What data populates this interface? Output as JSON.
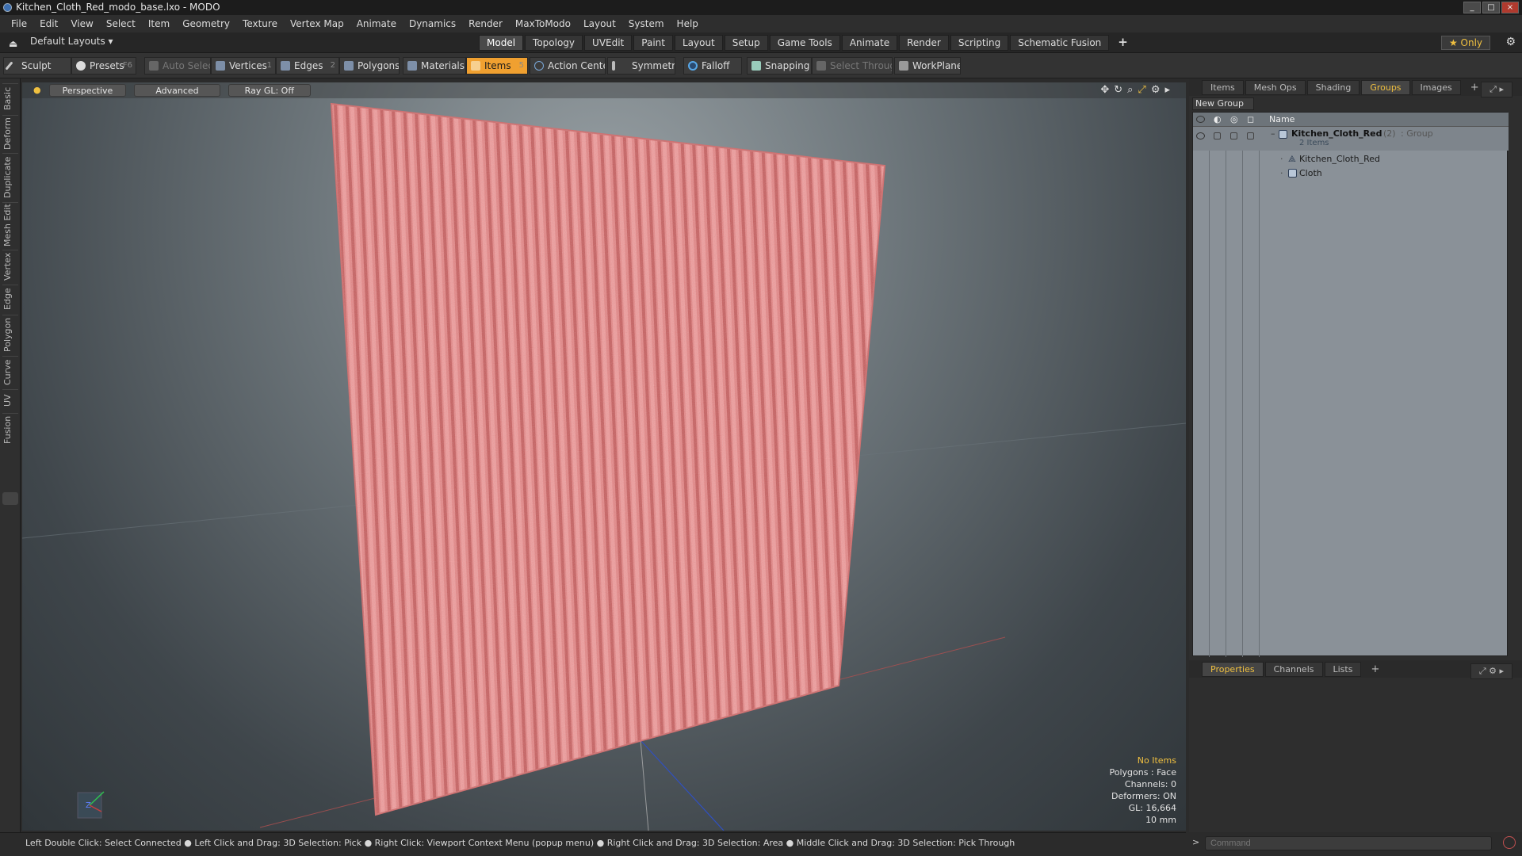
{
  "window": {
    "title": "Kitchen_Cloth_Red_modo_base.lxo - MODO"
  },
  "menu": [
    "File",
    "Edit",
    "View",
    "Select",
    "Item",
    "Geometry",
    "Texture",
    "Vertex Map",
    "Animate",
    "Dynamics",
    "Render",
    "MaxToModo",
    "Layout",
    "System",
    "Help"
  ],
  "layout_selector": "Default Layouts",
  "tabs": [
    "Model",
    "Topology",
    "UVEdit",
    "Paint",
    "Layout",
    "Setup",
    "Game Tools",
    "Animate",
    "Render",
    "Scripting",
    "Schematic Fusion"
  ],
  "active_tab": "Model",
  "tabs_plus": "+",
  "only_label": "★ Only",
  "toolbar": {
    "sculpt": "Sculpt",
    "presets": "Presets",
    "presets_key": "F6",
    "auto_select": "Auto Select",
    "vertices": "Vertices",
    "vertices_key": "1",
    "edges": "Edges",
    "edges_key": "2",
    "polygons": "Polygons",
    "materials": "Materials",
    "items": "Items",
    "items_key": "5",
    "action_center": "Action Center",
    "symmetry": "Symmetry",
    "falloff": "Falloff",
    "snapping": "Snapping",
    "select_through": "Select Through",
    "workplane": "WorkPlane"
  },
  "left_tabs": [
    "Basic",
    "Deform",
    "Duplicate",
    "Mesh Edit",
    "Vertex",
    "Edge",
    "Polygon",
    "Curve",
    "UV",
    "Fusion"
  ],
  "viewport": {
    "view": "Perspective",
    "shading": "Advanced",
    "raygl": "Ray GL: Off",
    "info": {
      "selection": "No Items",
      "polygons": "Polygons : Face",
      "channels": "Channels: 0",
      "deformers": "Deformers: ON",
      "gl": "GL: 16,664",
      "scale": "10 mm"
    },
    "axis_label": "Z",
    "cloth_color": "#e07c7c"
  },
  "status": "Left Double Click: Select Connected ● Left Click and Drag: 3D Selection: Pick ● Right Click: Viewport Context Menu (popup menu) ● Right Click and Drag: 3D Selection: Area ● Middle Click and Drag: 3D Selection: Pick Through",
  "right_top_tabs": [
    "Items",
    "Mesh Ops",
    "Shading",
    "Groups",
    "Images"
  ],
  "right_active_tab": "Groups",
  "new_group": "New Group",
  "groups": {
    "header_name": "Name",
    "group_name": "Kitchen_Cloth_Red",
    "group_count": "(2)",
    "group_type": ": Group",
    "group_items": "2 Items",
    "children": [
      "Kitchen_Cloth_Red",
      "Cloth"
    ]
  },
  "bottom_tabs": [
    "Properties",
    "Channels",
    "Lists"
  ],
  "bottom_active_tab": "Properties",
  "command_placeholder": "Command"
}
